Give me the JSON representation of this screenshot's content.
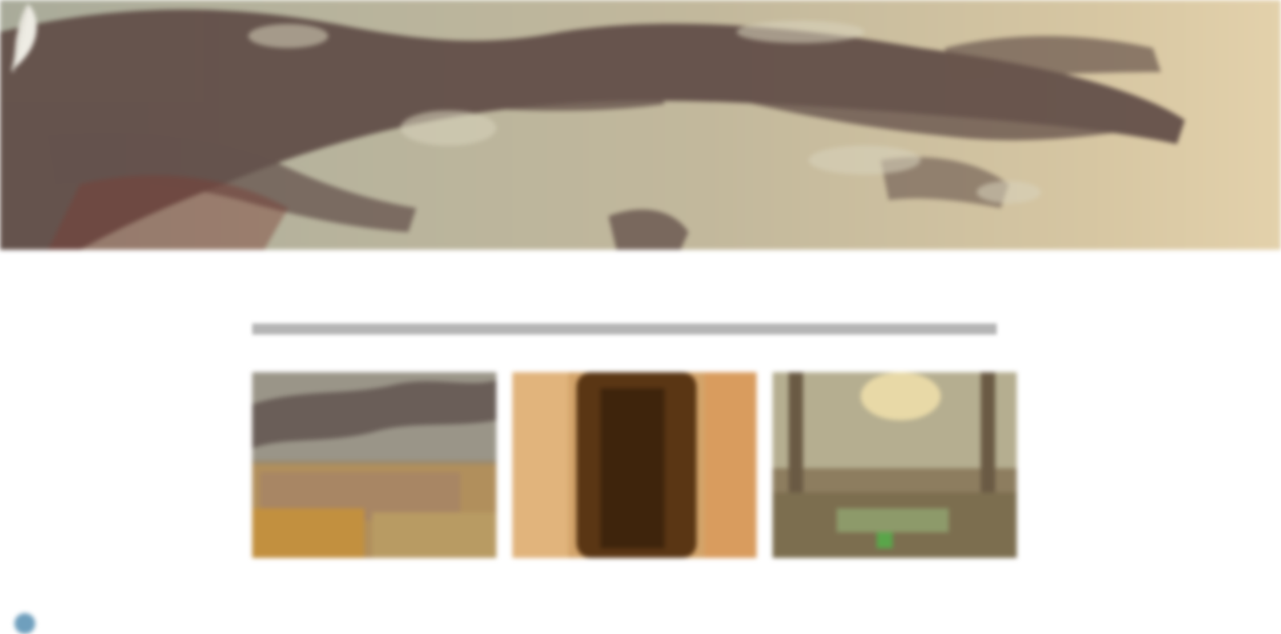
{
  "hero": {
    "title": "",
    "logo_icon": "feather-icon"
  },
  "intro": {
    "line1": "",
    "line2": ""
  },
  "gallery": {
    "items": [
      {
        "alt": ""
      },
      {
        "alt": ""
      },
      {
        "alt": ""
      }
    ]
  },
  "footer": {
    "line1": "",
    "line2": ""
  },
  "colors": {
    "hero_base": "#b7b39c",
    "branch_dark": "#5a4540",
    "page_bg": "#ffffff",
    "text_gray": "#8a8a8a"
  }
}
